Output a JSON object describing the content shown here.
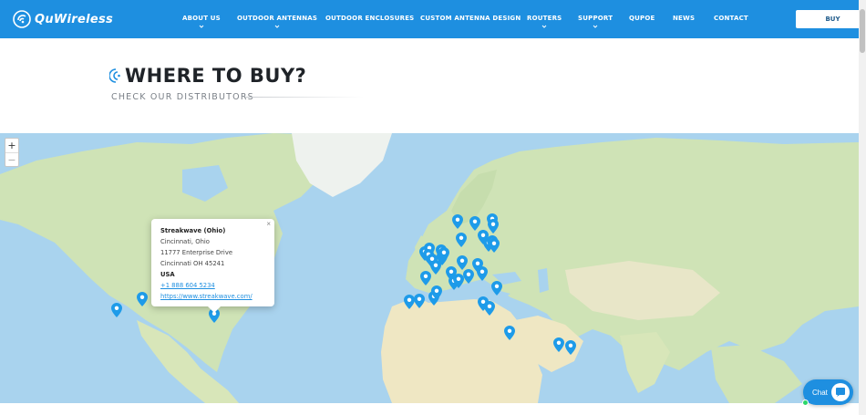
{
  "header": {
    "logo_text": "QuWireless",
    "nav": [
      {
        "label": "ABOUT US",
        "has_dropdown": true
      },
      {
        "label": "OUTDOOR ANTENNAS",
        "has_dropdown": true
      },
      {
        "label": "OUTDOOR ENCLOSURES",
        "has_dropdown": false
      },
      {
        "label": "CUSTOM ANTENNA DESIGN",
        "has_dropdown": false
      },
      {
        "label": "ROUTERS",
        "has_dropdown": true
      },
      {
        "label": "SUPPORT",
        "has_dropdown": true
      },
      {
        "label": "QUPOE",
        "has_dropdown": false
      },
      {
        "label": "NEWS",
        "has_dropdown": false
      },
      {
        "label": "CONTACT",
        "has_dropdown": false
      }
    ],
    "buy_label": "BUY"
  },
  "hero": {
    "title": "WHERE TO BUY?",
    "subtitle": "CHECK OUR DISTRIBUTORS"
  },
  "map": {
    "zoom_in": "+",
    "zoom_out": "−",
    "popup": {
      "name": "Streakwave (Ohio)",
      "city": "Cincinnati, Ohio",
      "street": "11777 Enterprise Drive",
      "city_zip": "Cincinnati OH 45241",
      "country": "USA",
      "phone": "+1 888 604 5234",
      "website": "https://www.streakwave.com/",
      "close": "×"
    },
    "pin_color": "#1e9be9"
  },
  "chat": {
    "label": "Chat"
  },
  "colors": {
    "header_bg": "#1e8fe0",
    "water": "#a9d3ee",
    "land": "#cfe3b6",
    "desert": "#efe7c3"
  }
}
